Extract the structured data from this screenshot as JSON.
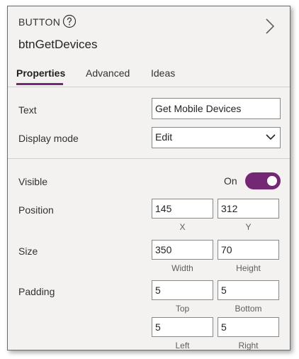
{
  "header": {
    "control_type": "BUTTON",
    "control_name": "btnGetDevices",
    "help_icon": "question-circle-icon",
    "expand_icon": "chevron-right-icon"
  },
  "tabs": [
    {
      "label": "Properties",
      "active": true
    },
    {
      "label": "Advanced",
      "active": false
    },
    {
      "label": "Ideas",
      "active": false
    }
  ],
  "properties": {
    "text": {
      "label": "Text",
      "value": "Get Mobile Devices"
    },
    "display_mode": {
      "label": "Display mode",
      "value": "Edit"
    },
    "visible": {
      "label": "Visible",
      "state_label": "On",
      "on": true
    },
    "position": {
      "label": "Position",
      "x": "145",
      "y": "312",
      "x_caption": "X",
      "y_caption": "Y"
    },
    "size": {
      "label": "Size",
      "width": "350",
      "height": "70",
      "width_caption": "Width",
      "height_caption": "Height"
    },
    "padding": {
      "label": "Padding",
      "top": "5",
      "bottom": "5",
      "left": "5",
      "right": "5",
      "top_caption": "Top",
      "bottom_caption": "Bottom",
      "left_caption": "Left",
      "right_caption": "Right"
    }
  },
  "colors": {
    "accent": "#742774",
    "panel_bg": "#f3f2f1",
    "field_border": "#8a8886"
  }
}
